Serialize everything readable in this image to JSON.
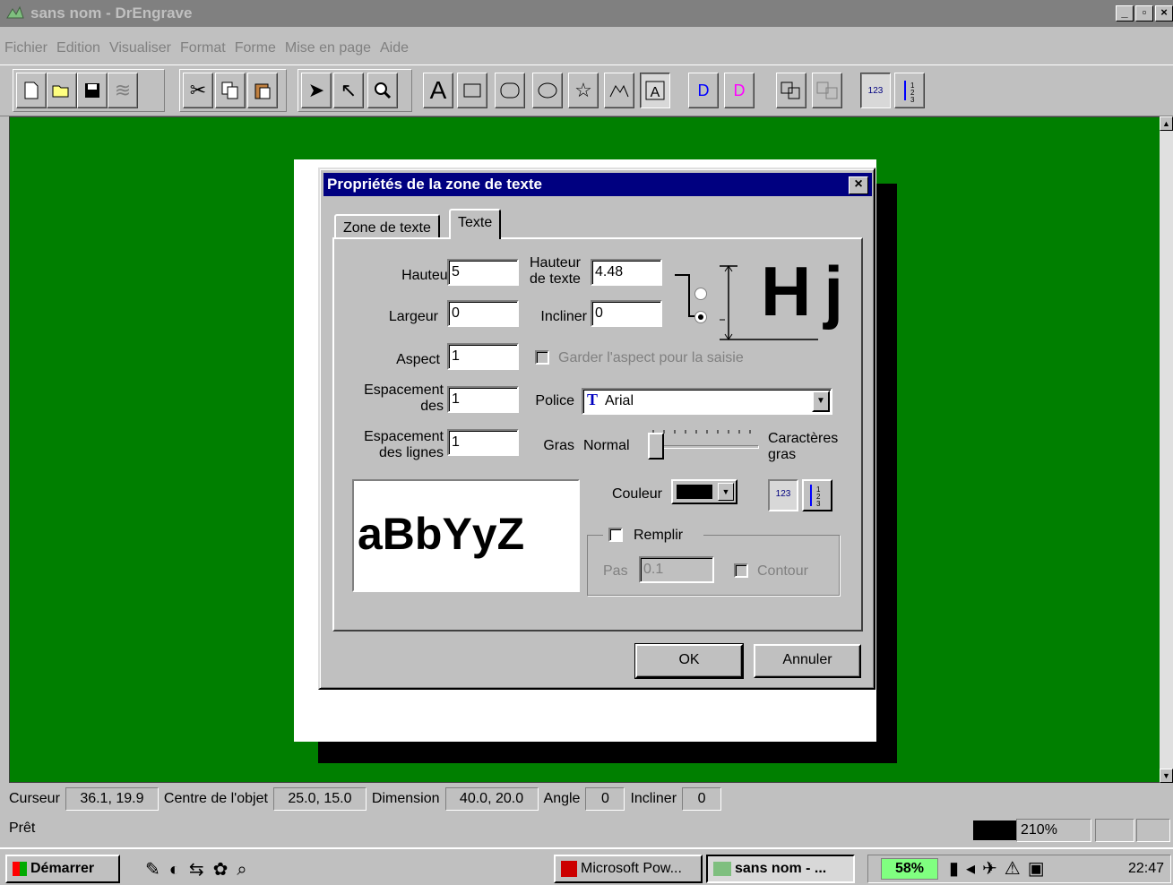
{
  "window": {
    "title": "sans nom - DrEngrave"
  },
  "menu": [
    "Fichier",
    "Edition",
    "Visualiser",
    "Format",
    "Forme",
    "Mise en page",
    "Aide"
  ],
  "toolbar": {
    "text_tool_label": "A",
    "duplicate_label": "D",
    "ruler_label": "123"
  },
  "dialog": {
    "title": "Propriétés de la zone de texte",
    "close": "×",
    "tabs": [
      "Zone de texte",
      "Texte"
    ],
    "hauteur_label": "Hauteur",
    "hauteur_value": "5",
    "hauteur_texte_label_1": "Hauteur",
    "hauteur_texte_label_2": "de texte",
    "hauteur_texte_value": "4.48",
    "largeur_label": "Largeur",
    "largeur_value": "0",
    "incliner_label": "Incliner",
    "incliner_value": "0",
    "aspect_label": "Aspect",
    "aspect_value": "1",
    "garder_label": "Garder l'aspect pour la saisie",
    "espacement_des_1": "Espacement",
    "espacement_des_2": "des",
    "espacement_des_value": "1",
    "police_label": "Police",
    "police_value": "Arial",
    "espacement_lignes_1": "Espacement",
    "espacement_lignes_2": "des lignes",
    "espacement_lignes_value": "1",
    "gras_label": "Gras",
    "normal_label": "Normal",
    "caracteres_1": "Caractères",
    "caracteres_2": "gras",
    "preview_text": "aBbYyZ",
    "couleur_label": "Couleur",
    "remplir_label": "Remplir",
    "pas_label": "Pas",
    "pas_value": "0.1",
    "contour_label": "Contour",
    "ok_label": "OK",
    "annuler_label": "Annuler",
    "hj_label": "Hj",
    "ruler_icon": "123"
  },
  "statusbar": {
    "curseur_label": "Curseur",
    "curseur_value": "36.1, 19.9",
    "centre_label": "Centre de l'objet",
    "centre_value": "25.0, 15.0",
    "dimension_label": "Dimension",
    "dimension_value": "40.0, 20.0",
    "angle_label": "Angle",
    "angle_value": "0",
    "incliner_label": "Incliner",
    "incliner_value": "0",
    "ready": "Prêt",
    "zoom": "210%"
  },
  "taskbar": {
    "start": "Démarrer",
    "task1": "Microsoft Pow...",
    "task2": "sans nom - ...",
    "battery": "58%",
    "clock": "22:47"
  }
}
